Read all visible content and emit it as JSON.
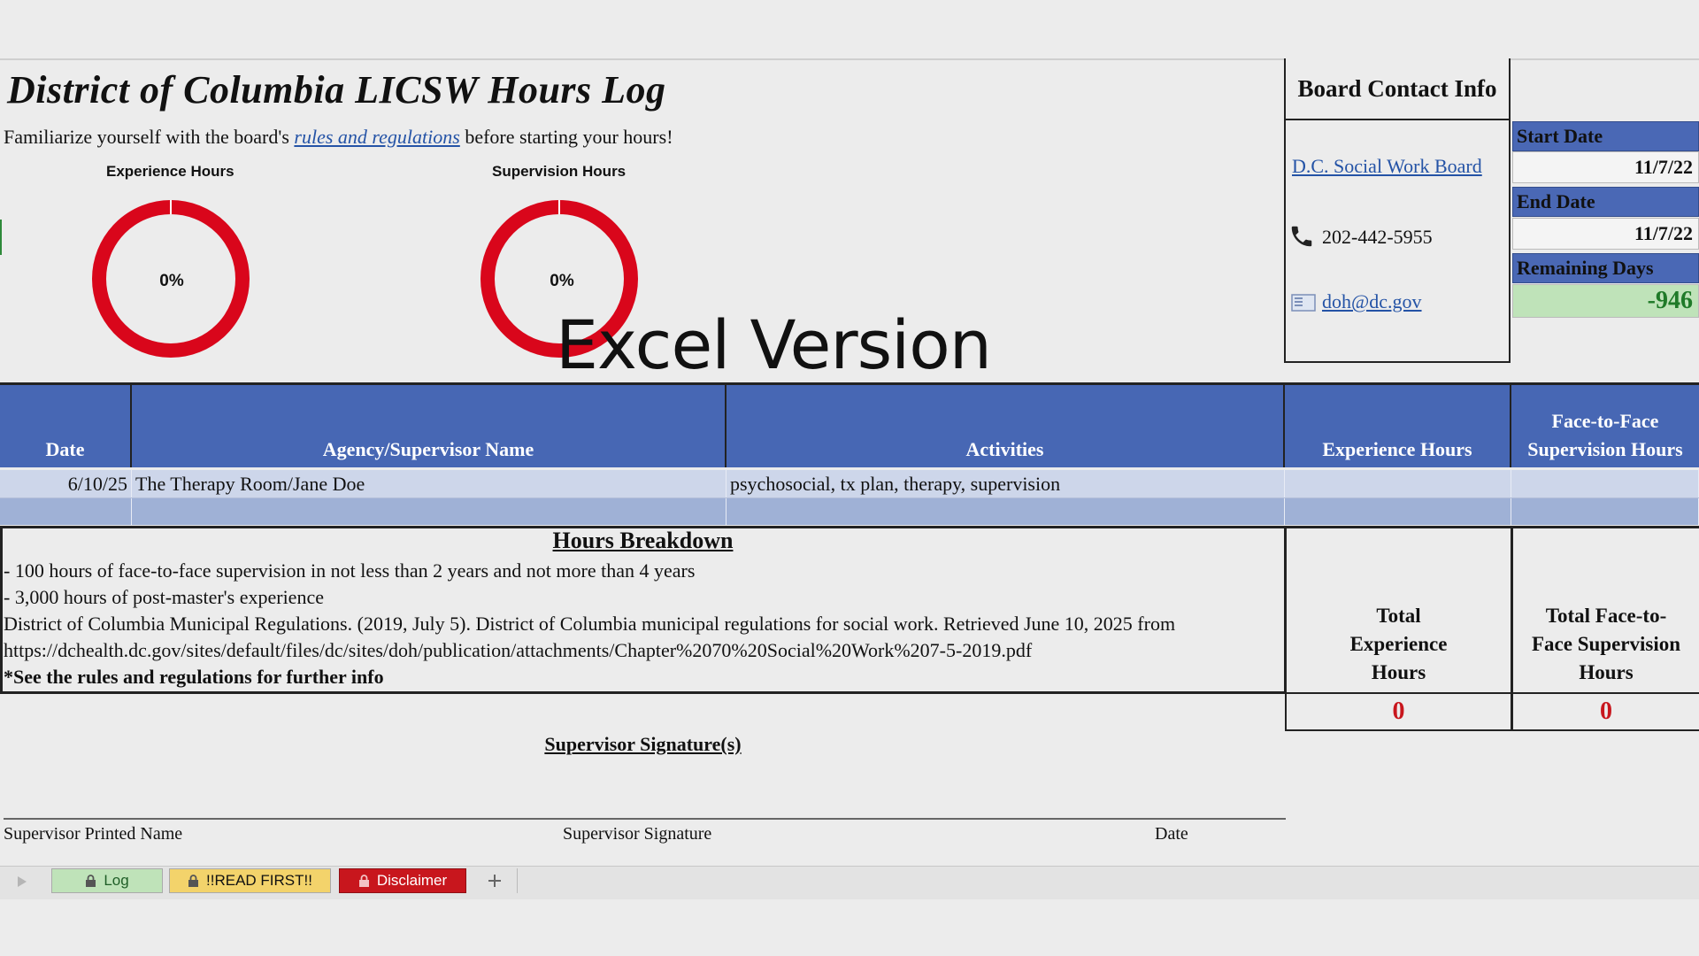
{
  "title": "District of Columbia LICSW Hours Log",
  "intro": {
    "before": "Familiarize yourself with the board's ",
    "link": "rules and regulations",
    "after": " before starting your hours!"
  },
  "gauges": [
    {
      "label": "Experience Hours",
      "value_text": "0%",
      "percent": 0,
      "color": "#d9061b"
    },
    {
      "label": "Supervision Hours",
      "value_text": "0%",
      "percent": 0,
      "color": "#d9061b"
    }
  ],
  "watermark": "Excel Version",
  "contact": {
    "header": "Board Contact Info",
    "board_link": "D.C. Social Work Board",
    "phone": "202-442-5955",
    "email": "doh@dc.gov"
  },
  "dates": {
    "start_label": "Start Date",
    "start_value": "11/7/22",
    "end_label": "End Date",
    "end_value": "11/7/22",
    "remaining_label": "Remaining Days",
    "remaining_value": "-946"
  },
  "table": {
    "headers": [
      "Date",
      "Agency/Supervisor Name",
      "Activities",
      "Experience Hours",
      "Face-to-Face Supervision Hours"
    ],
    "rows": [
      {
        "date": "6/10/25",
        "agency": "The Therapy Room/Jane Doe",
        "activities": "psychosocial, tx plan, therapy, supervision",
        "experience": "",
        "supervision": ""
      }
    ]
  },
  "breakdown": {
    "title": "Hours Breakdown",
    "lines": [
      "- 100 hours of face-to-face supervision in not less than 2 years and not more than 4 years",
      "- 3,000 hours of post-master's experience",
      "District of Columbia Municipal Regulations. (2019, July 5). District of Columbia municipal regulations for social work. Retrieved June 10, 2025 from",
      "https://dchealth.dc.gov/sites/default/files/dc/sites/doh/publication/attachments/Chapter%2070%20Social%20Work%207-5-2019.pdf"
    ],
    "note": "*See the rules and regulations for further info"
  },
  "totals": {
    "experience_label": "Total Experience Hours",
    "experience_value": "0",
    "supervision_label": "Total Face-to-Face Supervision Hours",
    "supervision_value": "0"
  },
  "signature": {
    "title": "Supervisor Signature(s)",
    "printed_name": "Supervisor Printed Name",
    "signature": "Supervisor Signature",
    "date": "Date"
  },
  "tabs": [
    {
      "label": "Log",
      "color": "#bfe3b9",
      "text_color": "#1f5e27"
    },
    {
      "label": "!!READ FIRST!!",
      "color": "#f3d36b",
      "text_color": "#111111"
    },
    {
      "label": "Disclaimer",
      "color": "#c8161d",
      "text_color": "#ffffff"
    }
  ],
  "icons": {
    "phone": "phone-icon",
    "email": "email-icon",
    "lock": "lock-icon",
    "add_sheet": "plus-icon",
    "nav": "play-arrow-icon"
  }
}
